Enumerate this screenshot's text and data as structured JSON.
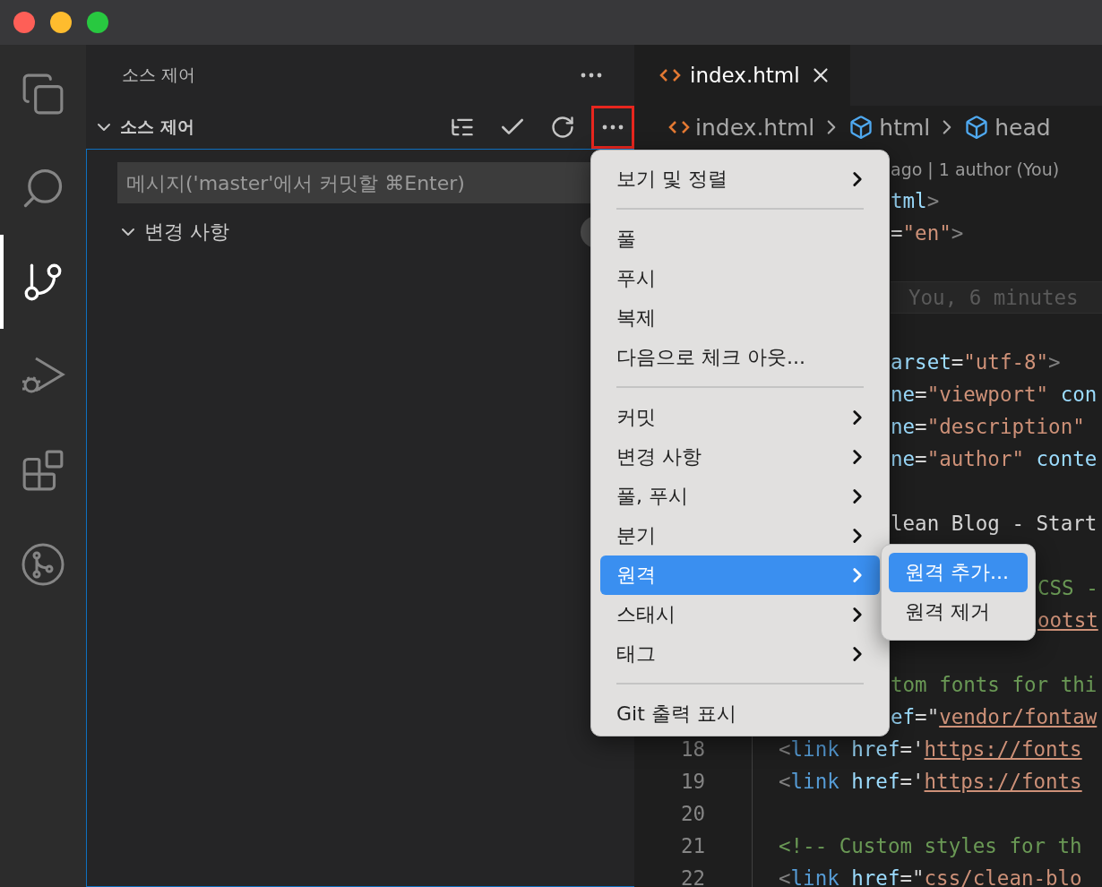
{
  "activity_bar": {
    "items": [
      {
        "kind": "explorer",
        "selected": false
      },
      {
        "kind": "search",
        "selected": false
      },
      {
        "kind": "source-control",
        "selected": true
      },
      {
        "kind": "run",
        "selected": false
      },
      {
        "kind": "extensions",
        "selected": false
      },
      {
        "kind": "git-graph",
        "selected": false
      }
    ]
  },
  "sidebar": {
    "title": "소스 제어",
    "section": {
      "title": "소스 제어",
      "expanded": true,
      "more_highlighted": true
    },
    "commit_input": {
      "placeholder": "메시지('master'에서 커밋할 ⌘Enter)"
    },
    "changes": {
      "title": "변경 사항",
      "expanded": true
    }
  },
  "editor": {
    "tabs": [
      {
        "label": "index.html",
        "selected": true
      }
    ],
    "breadcrumbs": [
      {
        "label": "index.html",
        "kind": "file"
      },
      {
        "label": "html",
        "kind": "element"
      },
      {
        "label": "head",
        "kind": "element"
      }
    ],
    "code_lines": [
      {
        "kind": "menu",
        "tokens": [
          {
            "t": "ago | 1 author (You)",
            "kind": "blame"
          }
        ]
      },
      {
        "kind": "menu",
        "tokens": [
          {
            "t": "tml",
            "kind": "tag"
          },
          {
            "t": ">",
            "kind": "punct"
          }
        ]
      },
      {
        "kind": "menu",
        "tokens": [
          {
            "t": "=",
            "kind": "text"
          },
          {
            "t": "\"en\"",
            "kind": "str"
          },
          {
            "t": ">",
            "kind": "punct"
          }
        ]
      },
      {
        "kind": "menu"
      },
      {
        "kind": "blame",
        "tokens": [
          {
            "t": "You, 6 minutes",
            "kind": "blame-mono"
          }
        ]
      },
      {
        "kind": "menu"
      },
      {
        "kind": "menu",
        "tokens": [
          {
            "t": "arset",
            "kind": "attr"
          },
          {
            "t": "=",
            "kind": "text"
          },
          {
            "t": "\"utf-8\"",
            "kind": "str"
          },
          {
            "t": ">",
            "kind": "punct"
          }
        ]
      },
      {
        "kind": "menu",
        "tokens": [
          {
            "t": "ne",
            "kind": "attr"
          },
          {
            "t": "=",
            "kind": "text"
          },
          {
            "t": "\"viewport\"",
            "kind": "str"
          },
          {
            "t": " con",
            "kind": "attr"
          }
        ]
      },
      {
        "kind": "menu",
        "tokens": [
          {
            "t": "ne",
            "kind": "attr"
          },
          {
            "t": "=",
            "kind": "text"
          },
          {
            "t": "\"description\"",
            "kind": "str"
          }
        ]
      },
      {
        "kind": "menu",
        "tokens": [
          {
            "t": "ne",
            "kind": "attr"
          },
          {
            "t": "=",
            "kind": "text"
          },
          {
            "t": "\"author\"",
            "kind": "str"
          },
          {
            "t": " conte",
            "kind": "attr"
          }
        ]
      },
      {
        "kind": "menu"
      },
      {
        "kind": "menu",
        "tokens": [
          {
            "t": "lean Blog - Start",
            "kind": "text"
          }
        ]
      },
      {
        "kind": "menu"
      },
      {
        "kind": "submenu",
        "tokens": [
          {
            "t": "CSS -",
            "kind": "comment"
          }
        ]
      },
      {
        "kind": "submenu",
        "tokens": [
          {
            "t": "ootst",
            "kind": "link"
          }
        ]
      },
      {
        "kind": "menu"
      },
      {
        "kind": "menu",
        "tokens": [
          {
            "t": "tom fonts for thi",
            "kind": "comment"
          }
        ]
      },
      {
        "kind": "menu",
        "tokens": [
          {
            "t": "ef",
            "kind": "attr"
          },
          {
            "t": "=\"",
            "kind": "text"
          },
          {
            "t": "vendor/fontaw",
            "kind": "link"
          }
        ]
      },
      {
        "kind": "full",
        "number": "18",
        "tokens": [
          {
            "t": "<",
            "kind": "punct"
          },
          {
            "t": "link",
            "kind": "tag2"
          },
          {
            "t": " href",
            "kind": "attr"
          },
          {
            "t": "='",
            "kind": "text"
          },
          {
            "t": "https://fonts",
            "kind": "link"
          }
        ]
      },
      {
        "kind": "full",
        "number": "19",
        "tokens": [
          {
            "t": "<",
            "kind": "punct"
          },
          {
            "t": "link",
            "kind": "tag2"
          },
          {
            "t": " href",
            "kind": "attr"
          },
          {
            "t": "='",
            "kind": "text"
          },
          {
            "t": "https://fonts",
            "kind": "link"
          }
        ]
      },
      {
        "kind": "full",
        "number": "20"
      },
      {
        "kind": "full",
        "number": "21",
        "tokens": [
          {
            "t": "<!-- Custom styles for th",
            "kind": "comment"
          }
        ]
      },
      {
        "kind": "full",
        "number": "22",
        "tokens": [
          {
            "t": "<",
            "kind": "punct"
          },
          {
            "t": "link",
            "kind": "tag2"
          },
          {
            "t": " href",
            "kind": "attr"
          },
          {
            "t": "=\"",
            "kind": "text"
          },
          {
            "t": "css/clean-blo",
            "kind": "link"
          }
        ]
      }
    ]
  },
  "context_menu": {
    "groups": [
      [
        {
          "label": "보기 및 정렬",
          "submenu": true,
          "selected": false
        }
      ],
      [
        {
          "label": "풀",
          "submenu": false,
          "selected": false
        },
        {
          "label": "푸시",
          "submenu": false,
          "selected": false
        },
        {
          "label": "복제",
          "submenu": false,
          "selected": false
        },
        {
          "label": "다음으로 체크 아웃...",
          "submenu": false,
          "selected": false
        }
      ],
      [
        {
          "label": "커밋",
          "submenu": true,
          "selected": false
        },
        {
          "label": "변경 사항",
          "submenu": true,
          "selected": false
        },
        {
          "label": "풀, 푸시",
          "submenu": true,
          "selected": false
        },
        {
          "label": "분기",
          "submenu": true,
          "selected": false
        },
        {
          "label": "원격",
          "submenu": true,
          "selected": true
        },
        {
          "label": "스태시",
          "submenu": true,
          "selected": false
        },
        {
          "label": "태그",
          "submenu": true,
          "selected": false
        }
      ],
      [
        {
          "label": "Git 출력 표시",
          "submenu": false,
          "selected": false
        }
      ]
    ],
    "submenu": {
      "items": [
        {
          "label": "원격 추가...",
          "selected": true
        },
        {
          "label": "원격 제거",
          "selected": false
        }
      ]
    }
  }
}
